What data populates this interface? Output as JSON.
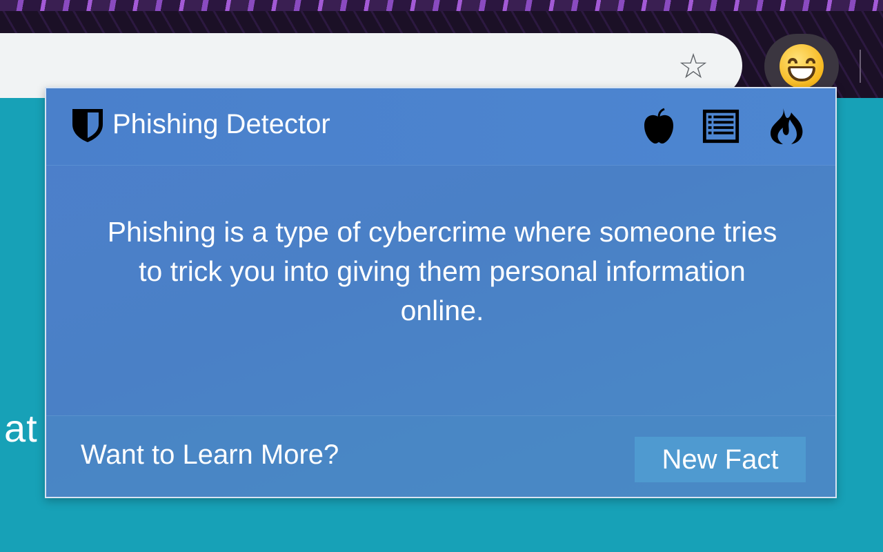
{
  "popup": {
    "title": "Phishing Detector",
    "fact": "Phishing is a type of cybercrime where someone tries to trick you into giving them personal information online.",
    "learn_more": "Want to Learn More?",
    "new_fact_label": "New Fact",
    "header_icons": [
      "apple-icon",
      "list-icon",
      "fire-icon"
    ]
  },
  "page": {
    "fragment_text": "at"
  },
  "colors": {
    "page_background": "#17a1b7",
    "popup_background": "#4a80c6",
    "button_background": "#4f9ad0",
    "text": "#ffffff"
  }
}
